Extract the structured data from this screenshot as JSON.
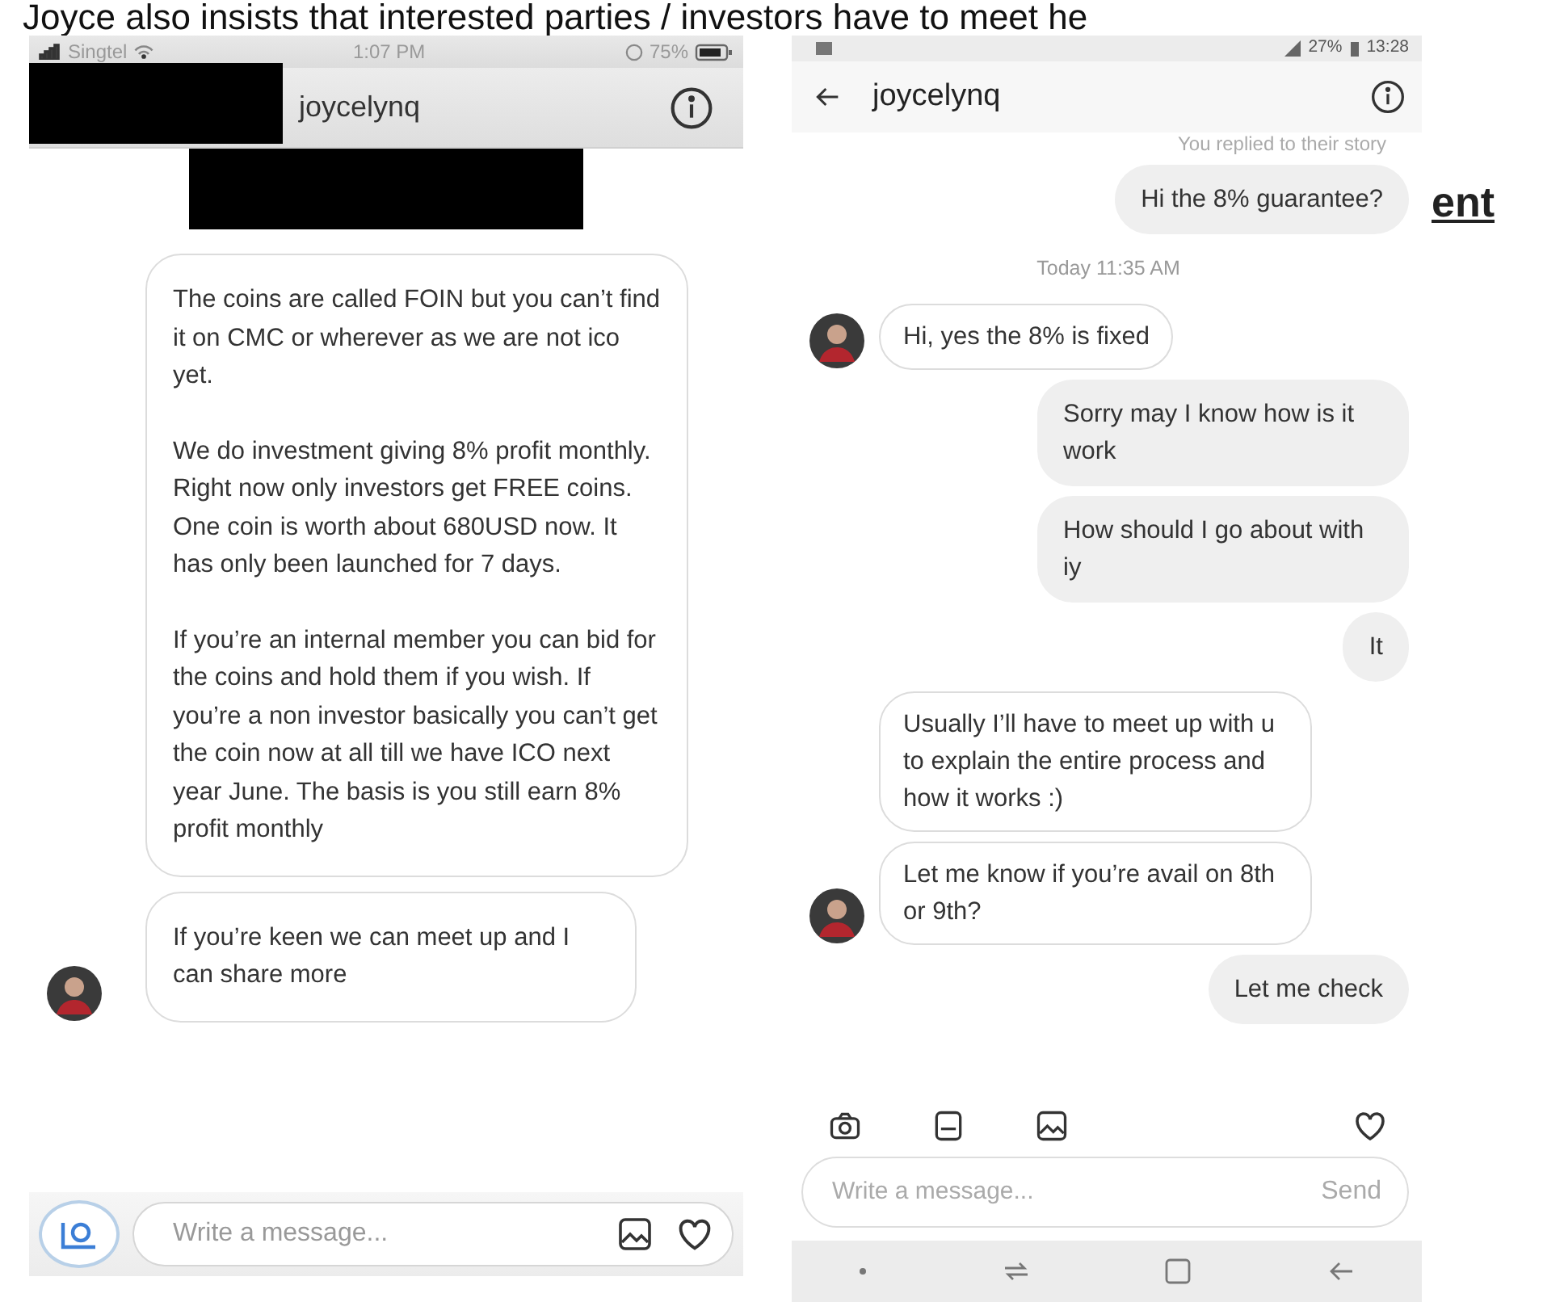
{
  "article": {
    "heading_fragment": "Joyce also insists that interested parties / investors have to meet he",
    "side_fragment": "ent"
  },
  "left_screenshot": {
    "status_bar": {
      "carrier": "Singtel",
      "time": "1:07 PM",
      "battery": "75%"
    },
    "title": "joycelynq",
    "messages": [
      {
        "kind": "received",
        "avatar": false,
        "paragraphs": [
          "The coins are called FOIN but you can’t find it on CMC or wherever as we are not ico yet.",
          "We do investment giving 8% profit monthly. Right now only investors get FREE coins. One coin is worth about 680USD now. It has only been launched for 7 days.",
          "If you’re an internal member you can bid for the coins and hold them if you wish. If you’re a non investor basically you can’t get the coin now at all till we have ICO next year June. The basis is you still earn 8% profit monthly"
        ]
      },
      {
        "kind": "received",
        "avatar": true,
        "paragraphs": [
          "If you’re keen we can meet up and I can share more"
        ]
      }
    ],
    "composer": {
      "placeholder": "Write a message..."
    }
  },
  "right_screenshot": {
    "status_bar": {
      "battery": "27%",
      "time": "13:28"
    },
    "title": "joycelynq",
    "story_note": "You replied to their story",
    "messages": [
      {
        "kind": "sent",
        "text": "Hi the 8% guarantee?"
      },
      {
        "kind": "timestamp",
        "text": "Today 11:35 AM"
      },
      {
        "kind": "received",
        "avatar": true,
        "text": "Hi, yes the 8% is fixed"
      },
      {
        "kind": "sent",
        "text": "Sorry may I know how is it work"
      },
      {
        "kind": "sent",
        "text": "How should I go about with iy"
      },
      {
        "kind": "sent",
        "text": "It"
      },
      {
        "kind": "received",
        "avatar": false,
        "text": "Usually I’ll have to meet up with u to explain the entire process and how it works :)"
      },
      {
        "kind": "received",
        "avatar": true,
        "text": "Let me know if you’re avail on 8th or 9th?"
      },
      {
        "kind": "sent",
        "text": "Let me check"
      }
    ],
    "composer": {
      "placeholder": "Write a message...",
      "send": "Send"
    }
  }
}
